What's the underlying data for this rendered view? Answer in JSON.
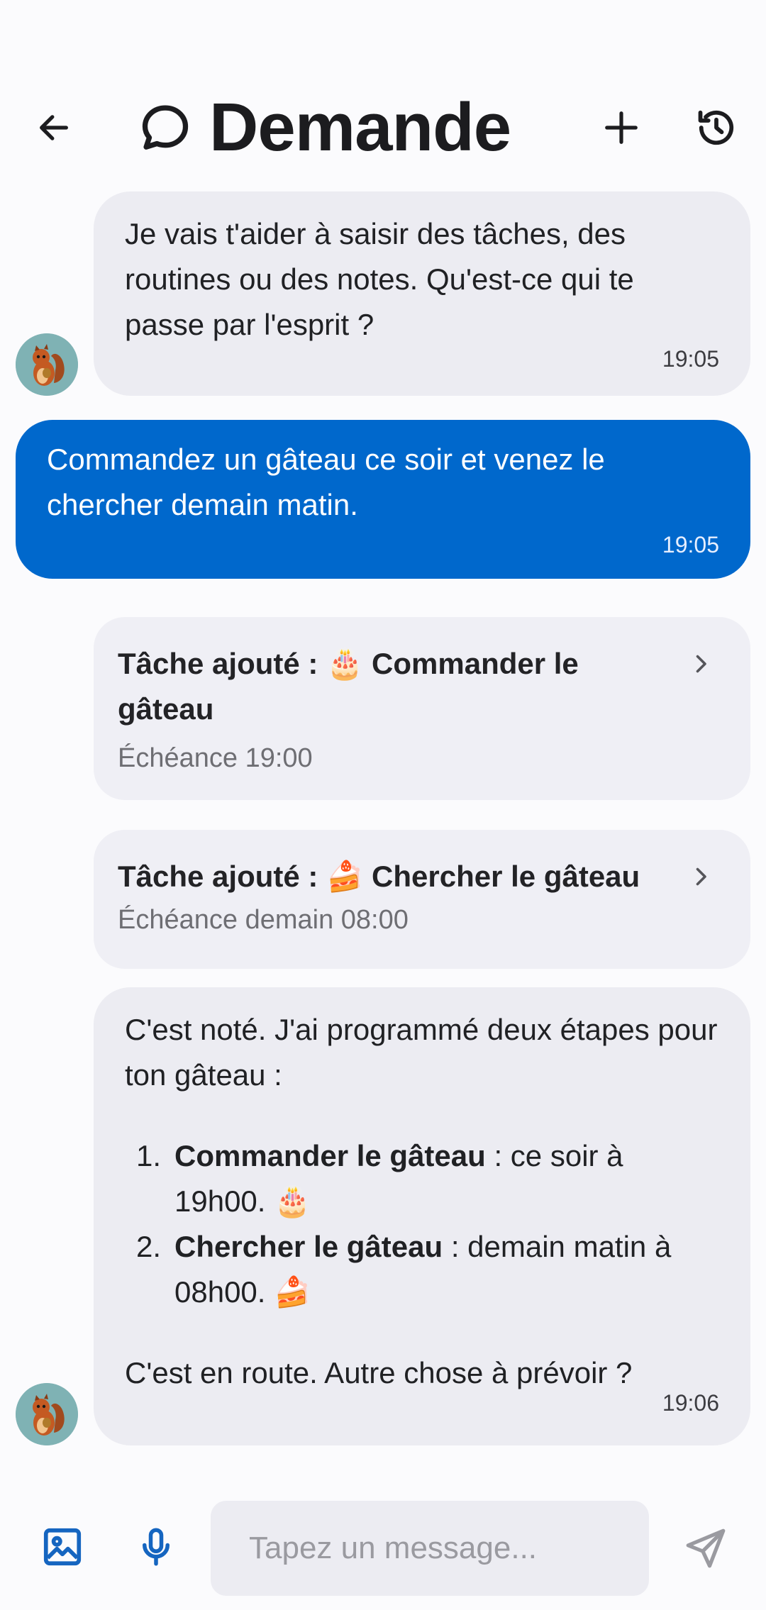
{
  "header": {
    "title": "Demande",
    "back_icon": "arrow-left-icon",
    "chat_icon": "speech-bubble-icon",
    "add_icon": "plus-icon",
    "history_icon": "history-clock-icon"
  },
  "messages": {
    "bot1": {
      "text": "Je vais t'aider à saisir des tâches, des routines ou des notes. Qu'est-ce qui te passe par l'esprit ?",
      "time": "19:05"
    },
    "user1": {
      "text": "Commandez un gâteau ce soir et venez le chercher demain matin.",
      "time": "19:05"
    },
    "task1": {
      "prefix": "Tâche ajouté :",
      "emoji": "🎂",
      "title": "Commander le gâteau",
      "due": "Échéance 19:00"
    },
    "task2": {
      "prefix": "Tâche ajouté :",
      "emoji": "🍰",
      "title": "Chercher le gâteau",
      "due": "Échéance demain 08:00"
    },
    "bot2": {
      "intro": "C'est noté. J'ai programmé deux étapes pour ton gâteau :",
      "items": [
        {
          "num": "1.",
          "bold": "Commander le gâteau",
          "rest": " : ce soir à 19h00.",
          "emoji": "🎂"
        },
        {
          "num": "2.",
          "bold": "Chercher le gâteau",
          "rest": " : demain matin à 08h00.",
          "emoji": "🍰"
        }
      ],
      "outro": "C'est en route. Autre chose à prévoir ?",
      "time": "19:06"
    }
  },
  "composer": {
    "placeholder": "Tapez un message...",
    "image_icon": "image-icon",
    "mic_icon": "microphone-icon",
    "send_icon": "send-icon"
  },
  "colors": {
    "accent": "#0068cc",
    "bubble_bg": "#ececf2",
    "icon_blue": "#1565c0"
  }
}
